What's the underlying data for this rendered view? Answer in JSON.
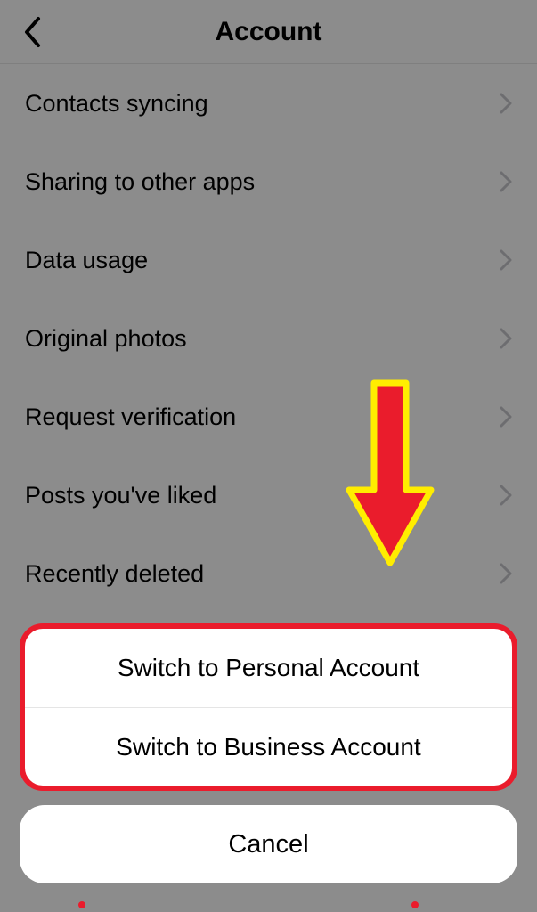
{
  "header": {
    "title": "Account"
  },
  "list": {
    "items": [
      {
        "label": "Contacts syncing"
      },
      {
        "label": "Sharing to other apps"
      },
      {
        "label": "Data usage"
      },
      {
        "label": "Original photos"
      },
      {
        "label": "Request verification"
      },
      {
        "label": "Posts you've liked"
      },
      {
        "label": "Recently deleted"
      }
    ]
  },
  "action_sheet": {
    "options": [
      {
        "label": "Switch to Personal Account"
      },
      {
        "label": "Switch to Business Account"
      }
    ],
    "cancel_label": "Cancel"
  }
}
